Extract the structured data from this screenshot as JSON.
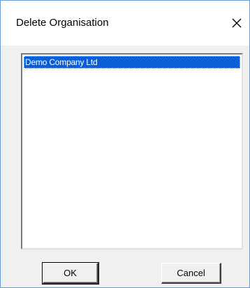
{
  "dialog": {
    "title": "Delete Organisation",
    "close_icon": "close-icon"
  },
  "organisation_list": {
    "items": [
      {
        "label": "Demo Company Ltd",
        "selected": true
      }
    ]
  },
  "buttons": {
    "ok_label": "OK",
    "cancel_label": "Cancel"
  },
  "colors": {
    "selection_bg": "#0a5fd8",
    "selection_text": "#ffffff",
    "window_border": "#6b9bd1",
    "dialog_bg": "#f0f0f0"
  }
}
